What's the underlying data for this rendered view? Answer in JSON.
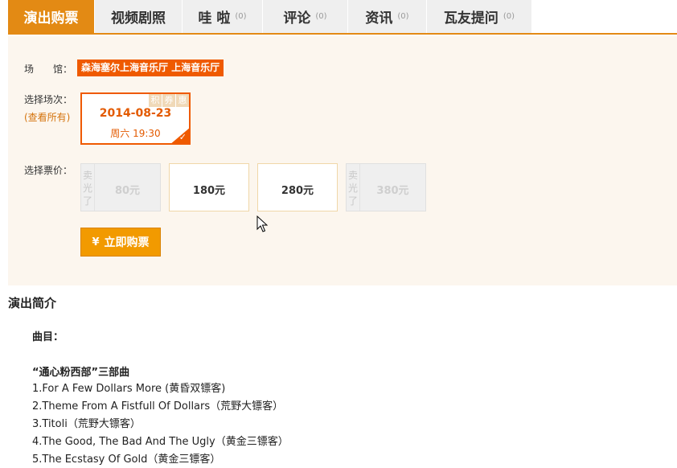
{
  "tabs": [
    {
      "label": "演出购票",
      "count": ""
    },
    {
      "label": "视频剧照",
      "count": ""
    },
    {
      "label": "哇 啦",
      "count": "(0)"
    },
    {
      "label": "评论",
      "count": "(0)"
    },
    {
      "label": "资讯",
      "count": "(0)"
    },
    {
      "label": "瓦友提问",
      "count": "(0)"
    }
  ],
  "venue": {
    "label": "场　　馆：",
    "name": "森海塞尔上海音乐厅 上海音乐厅"
  },
  "session_section": {
    "label": "选择场次：",
    "view_all": "(查看所有)"
  },
  "session": {
    "badges": [
      "积",
      "券",
      "惠"
    ],
    "date": "2014-08-23",
    "time": "周六 19:30"
  },
  "price_section": {
    "label": "选择票价："
  },
  "prices": [
    {
      "value": "80元",
      "sold_out": "卖光了"
    },
    {
      "value": "180元",
      "sold_out": ""
    },
    {
      "value": "280元",
      "sold_out": ""
    },
    {
      "value": "380元",
      "sold_out": "卖光了"
    }
  ],
  "buy_button": {
    "symbol": "¥",
    "label": "立即购票"
  },
  "intro": {
    "title": "演出简介",
    "program_label": "曲目：",
    "suite_title": "“通心粉西部”三部曲",
    "tracks": [
      "1.For A Few Dollars More (黄昏双镖客)",
      "2.Theme From A Fistfull Of Dollars（荒野大镖客）",
      "3.Titoli（荒野大镖客）",
      "4.The Good, The Bad And The Ugly（黄金三镖客）",
      "5.The Ecstasy Of Gold（黄金三镖客）"
    ]
  },
  "colors": {
    "accent": "#e38a14",
    "venue_tag": "#ef5a00",
    "buy_button": "#f29a00",
    "panel_bg": "#fcf6ee"
  }
}
